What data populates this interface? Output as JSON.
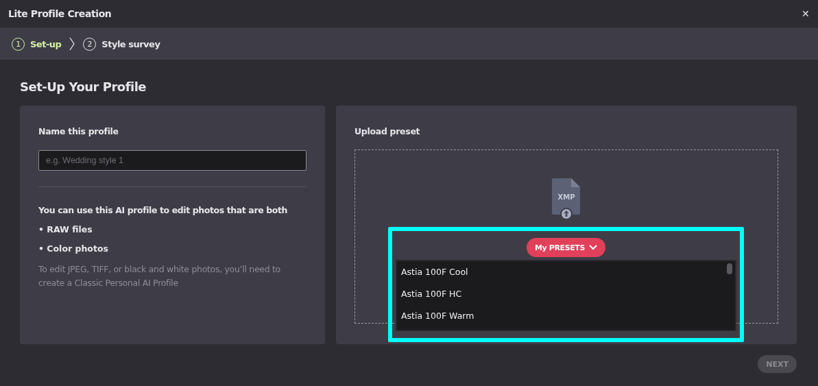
{
  "window": {
    "title": "Lite Profile Creation",
    "close": "✕"
  },
  "steps": [
    {
      "number": "1",
      "label": "Set-up",
      "selected": true
    },
    {
      "number": "2",
      "label": "Style survey",
      "selected": false
    }
  ],
  "heading": "Set-Up Your Profile",
  "name_card": {
    "label": "Name this profile",
    "placeholder": "e.g. Wedding style 1",
    "intro": "You can use this AI profile to edit photos that are both",
    "bullets": [
      "• RAW files",
      "• Color photos"
    ],
    "note": "To edit JPEG, TIFF, or black and white photos, you’ll need to create a Classic Personal AI Profile"
  },
  "upload_card": {
    "label": "Upload preset",
    "file_icon_text": "XMP",
    "presets": {
      "highlighted": true,
      "button": "My PRESETS",
      "items": [
        "Astia 100F Cool",
        "Astia 100F HC",
        "Astia 100F Warm"
      ]
    }
  },
  "next_button": {
    "label": "NEXT",
    "disabled": true
  }
}
